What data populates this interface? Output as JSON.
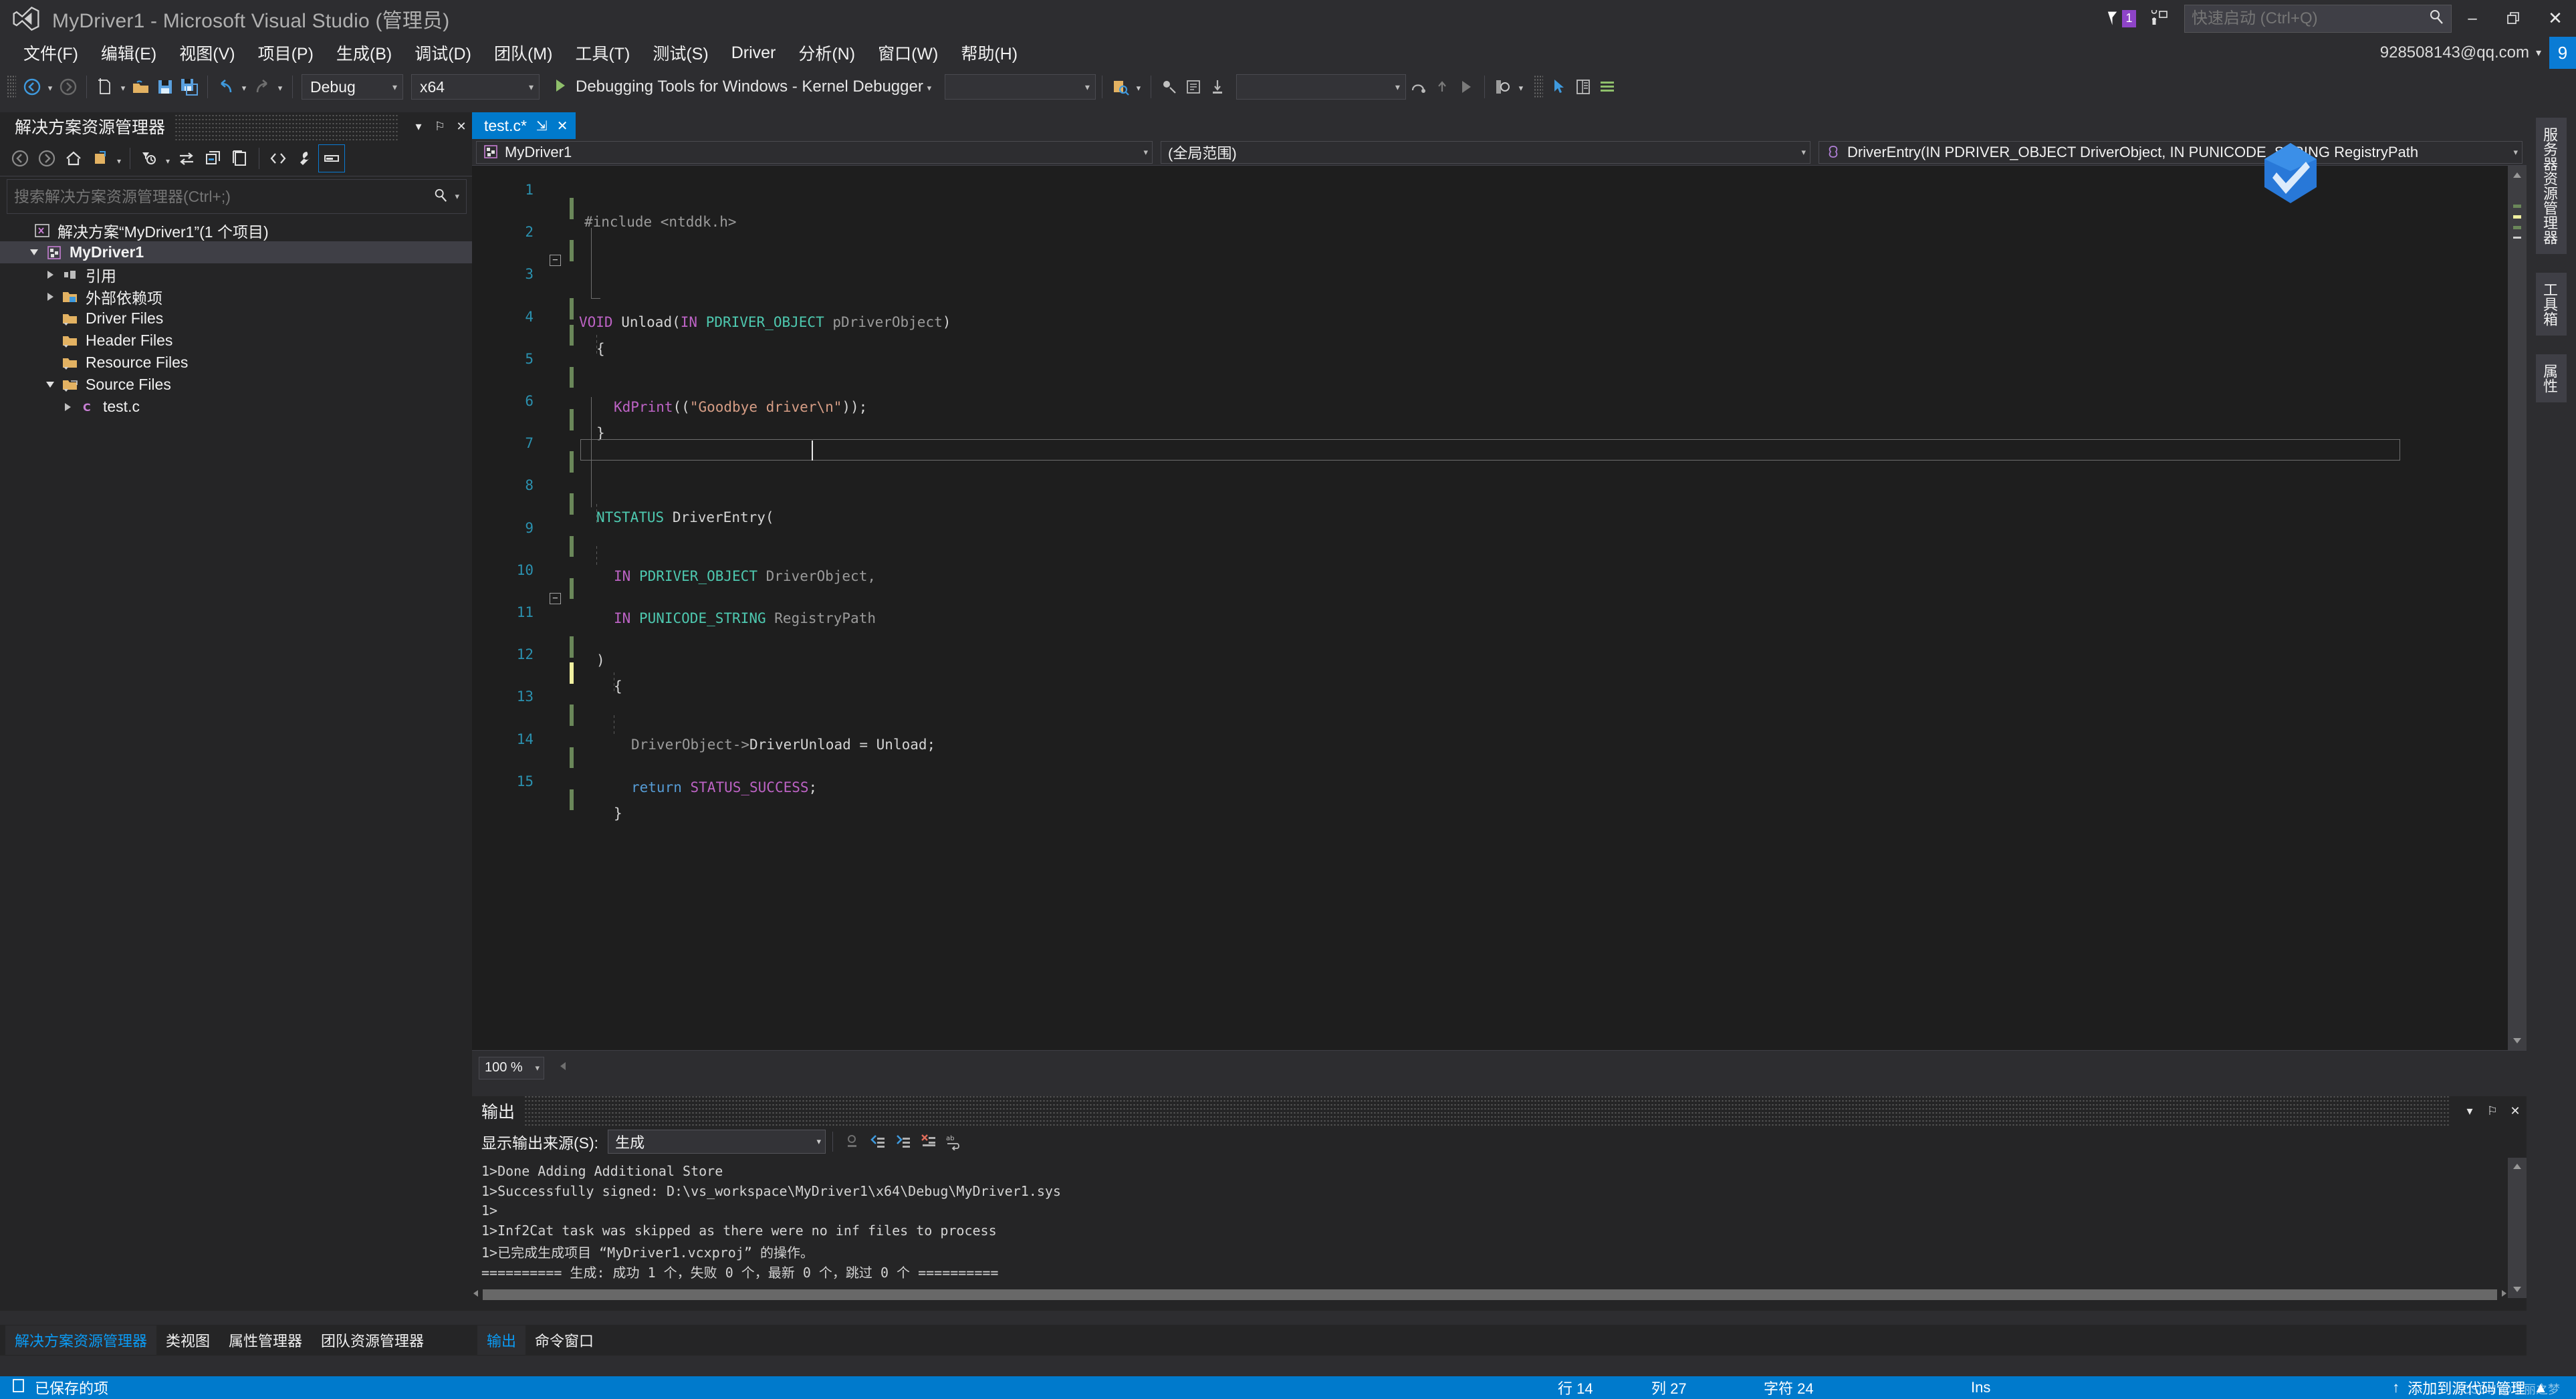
{
  "window": {
    "title": "MyDriver1 - Microsoft Visual Studio (管理员)",
    "minimize_label": "–",
    "restore_label": "❐",
    "close_label": "✕",
    "notification_count": "1"
  },
  "quick_launch": {
    "placeholder": "快速启动 (Ctrl+Q)",
    "value": "",
    "icon": "search-icon"
  },
  "account": {
    "email": "928508143@qq.com",
    "caret": "▾",
    "avatar_initial": "9"
  },
  "menu": {
    "items": [
      {
        "label": "文件(F)"
      },
      {
        "label": "编辑(E)"
      },
      {
        "label": "视图(V)"
      },
      {
        "label": "项目(P)"
      },
      {
        "label": "生成(B)"
      },
      {
        "label": "调试(D)"
      },
      {
        "label": "团队(M)"
      },
      {
        "label": "工具(T)"
      },
      {
        "label": "测试(S)"
      },
      {
        "label": "Driver"
      },
      {
        "label": "分析(N)"
      },
      {
        "label": "窗口(W)"
      },
      {
        "label": "帮助(H)"
      }
    ]
  },
  "toolbar": {
    "config": {
      "value": "Debug",
      "caret": "▾"
    },
    "platform": {
      "value": "x64",
      "caret": "▾"
    },
    "run": {
      "label": "Debugging Tools for Windows - Kernel Debugger",
      "caret": "▾"
    },
    "combo_empty_1": "",
    "combo_empty_2": "",
    "caret": "▾"
  },
  "solution_explorer": {
    "title": "解决方案资源管理器",
    "header_buttons": [
      {
        "name": "dropdown-icon",
        "label": "▾"
      },
      {
        "name": "pin-icon",
        "label": "⚐"
      },
      {
        "name": "close-icon",
        "label": "✕"
      }
    ],
    "search": {
      "placeholder": "搜索解决方案资源管理器(Ctrl+;)",
      "value": ""
    },
    "tree": [
      {
        "label": "解决方案“MyDriver1”(1 个项目)",
        "indent": 0,
        "twisty": "none",
        "icon": "solution-icon",
        "bold": false,
        "selected": false
      },
      {
        "label": "MyDriver1",
        "indent": 1,
        "twisty": "down",
        "icon": "project-icon",
        "bold": true,
        "selected": true
      },
      {
        "label": "引用",
        "indent": 2,
        "twisty": "right",
        "icon": "references-icon",
        "bold": false,
        "selected": false
      },
      {
        "label": "外部依赖项",
        "indent": 2,
        "twisty": "right",
        "icon": "external-deps-icon",
        "bold": false,
        "selected": false
      },
      {
        "label": "Driver Files",
        "indent": 2,
        "twisty": "none",
        "icon": "folder-filter-icon",
        "bold": false,
        "selected": false
      },
      {
        "label": "Header Files",
        "indent": 2,
        "twisty": "none",
        "icon": "folder-filter-icon",
        "bold": false,
        "selected": false
      },
      {
        "label": "Resource Files",
        "indent": 2,
        "twisty": "none",
        "icon": "folder-filter-icon",
        "bold": false,
        "selected": false
      },
      {
        "label": "Source Files",
        "indent": 2,
        "twisty": "down",
        "icon": "folder-filter-open-icon",
        "bold": false,
        "selected": false
      },
      {
        "label": "test.c",
        "indent": 3,
        "twisty": "right",
        "icon": "c-file-icon",
        "bold": false,
        "selected": false
      }
    ]
  },
  "editor": {
    "tab": {
      "label": "test.c*",
      "pin": "⇲",
      "close": "✕"
    },
    "nav": {
      "project": "MyDriver1",
      "scope": "(全局范围)",
      "member": "DriverEntry(IN PDRIVER_OBJECT DriverObject, IN PUNICODE_STRING RegistryPath",
      "caret": "▾"
    },
    "zoom": {
      "value": "100 %",
      "caret": "▾"
    },
    "code_lines": [
      {
        "n": "1",
        "mark": "green",
        "fold": "none",
        "text": "    #include <ntddk.h>"
      },
      {
        "n": "2",
        "mark": "green",
        "fold": "none",
        "text": ""
      },
      {
        "n": "3",
        "mark": "green",
        "fold": "minus",
        "text": "VOID Unload(IN PDRIVER_OBJECT pDriverObject)"
      },
      {
        "n": "4",
        "mark": "green",
        "fold": "none",
        "text": "  {"
      },
      {
        "n": "5",
        "mark": "green",
        "fold": "none",
        "text": "      KdPrint((\"Goodbye driver\\n\"));"
      },
      {
        "n": "6",
        "mark": "green",
        "fold": "none",
        "text": "  }"
      },
      {
        "n": "7",
        "mark": "green",
        "fold": "none",
        "text": ""
      },
      {
        "n": "8",
        "mark": "green",
        "fold": "none",
        "text": "  NTSTATUS DriverEntry("
      },
      {
        "n": "9",
        "mark": "green",
        "fold": "none",
        "text": "      IN PDRIVER_OBJECT DriverObject,"
      },
      {
        "n": "10",
        "mark": "green",
        "fold": "none",
        "text": "      IN PUNICODE_STRING RegistryPath"
      },
      {
        "n": "11",
        "mark": "green",
        "fold": "minus",
        "text": "  )"
      },
      {
        "n": "12",
        "mark": "yellow",
        "fold": "none",
        "text": "  {"
      },
      {
        "n": "13",
        "mark": "green",
        "fold": "none",
        "text": "      DriverObject->DriverUnload = Unload;"
      },
      {
        "n": "14",
        "mark": "green",
        "fold": "none",
        "text": "      return STATUS_SUCCESS;"
      },
      {
        "n": "15",
        "mark": "green",
        "fold": "none",
        "text": "  }"
      }
    ]
  },
  "output": {
    "title": "输出",
    "header_buttons": [
      {
        "name": "dropdown-icon",
        "label": "▾"
      },
      {
        "name": "pin-icon",
        "label": "⚐"
      },
      {
        "name": "close-icon",
        "label": "✕"
      }
    ],
    "source_label": "显示输出来源(S):",
    "source_value": "生成",
    "source_caret": "▾",
    "lines": [
      "1>Done Adding Additional Store",
      "1>Successfully signed: D:\\vs_workspace\\MyDriver1\\x64\\Debug\\MyDriver1.sys",
      "1>",
      "1>Inf2Cat task was skipped as there were no inf files to process",
      "1>已完成生成项目 “MyDriver1.vcxproj” 的操作。",
      "========== 生成: 成功 1 个，失败 0 个，最新 0 个，跳过 0 个 =========="
    ]
  },
  "right_tabs": [
    {
      "label": "服务器资源管理器"
    },
    {
      "label": "工具箱"
    },
    {
      "label": "属性"
    }
  ],
  "bottom_left_tabs": [
    {
      "label": "解决方案资源管理器",
      "active": true
    },
    {
      "label": "类视图",
      "active": false
    },
    {
      "label": "属性管理器",
      "active": false
    },
    {
      "label": "团队资源管理器",
      "active": false
    }
  ],
  "bottom_output_tabs": [
    {
      "label": "输出",
      "active": true
    },
    {
      "label": "命令窗口",
      "active": false
    }
  ],
  "status_bar": {
    "message": "已保存的项",
    "line": "行 14",
    "column": "列 27",
    "character": "字符 24",
    "insert_mode": "Ins",
    "source_control": "添加到源代码管理",
    "source_control_arrow": "▲",
    "up_arrow": "↑",
    "watermark": "CSDN @华丽之梦",
    "accent": "#007acc"
  },
  "colors": {
    "accent": "#007acc",
    "chrome": "#2d2d30",
    "panel": "#252526",
    "editor_bg": "#1e1e1e",
    "keyword": "#569cd6",
    "type": "#4ec9b0",
    "macro": "#bd63c5",
    "string": "#d69d85",
    "identifier": "#9b9b9b",
    "linenumber": "#2b91af",
    "changed_saved": "#6a8759",
    "changed_unsaved": "#f0f0a0",
    "badge_purple": "#8e44c8"
  }
}
